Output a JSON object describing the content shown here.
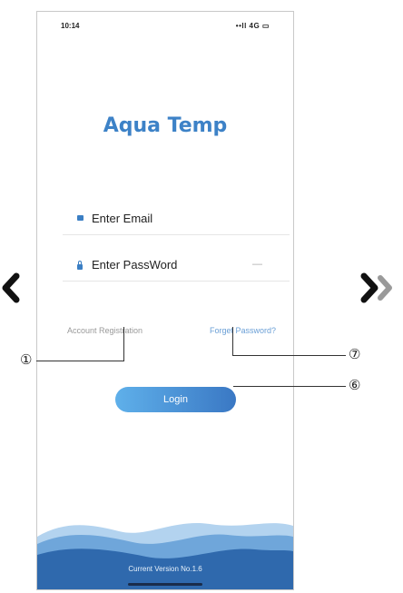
{
  "status_bar": {
    "time": "10:14",
    "icons": "••ll 4G ▭"
  },
  "app_title": "Aqua Temp",
  "login_form": {
    "email": {
      "placeholder": "Enter Email",
      "icon": "envelope-icon"
    },
    "password": {
      "placeholder": "Enter PassWord",
      "icon": "lock-icon",
      "toggle_text": "—"
    }
  },
  "links": {
    "register": "Account Registration",
    "forgot": "Forget Password?"
  },
  "login_button": "Login",
  "footer": {
    "version": "Current Version No.1.6"
  },
  "callouts": {
    "register": "①",
    "forgot": "⑦",
    "login": "⑥"
  },
  "nav": {
    "prev_icon": "chevron-left-icon",
    "next_icon": "chevron-right-icon"
  },
  "colors": {
    "brand": "#3d82c7",
    "button_start": "#5fb0ea",
    "button_end": "#3a78c4",
    "wave_dark": "#2f69ad",
    "wave_light": "#6fa6da"
  }
}
